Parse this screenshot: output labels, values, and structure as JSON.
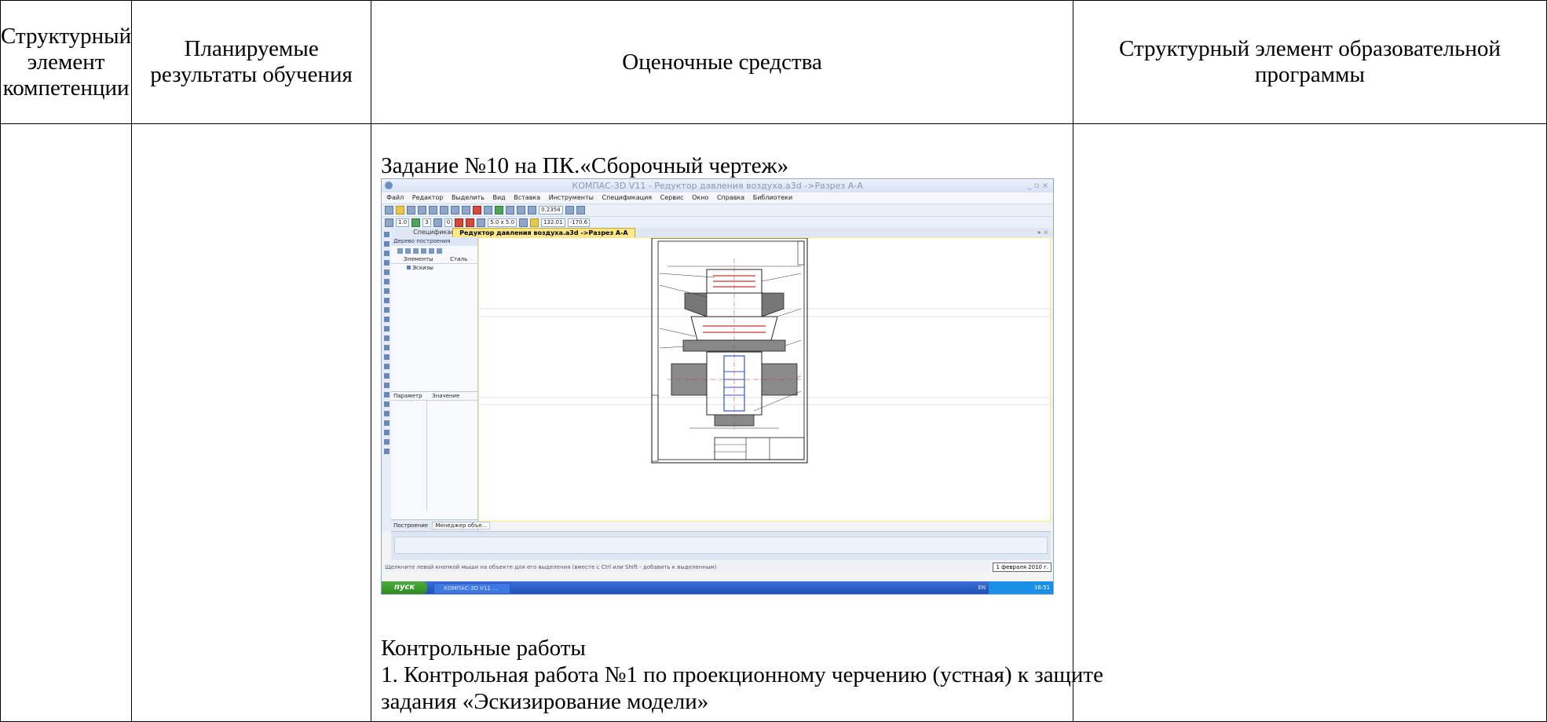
{
  "header": {
    "col1": "Структурный элемент компетенции",
    "col2": "Планируемые результаты обучения",
    "col3": "Оценочные средства",
    "col4": "Структурный элемент образовательной программы"
  },
  "content": {
    "task_title": "Задание №10 на ПК.«Сборочный чертеж»",
    "heading": "Контрольные работы",
    "item1_line1": "1. Контрольная работа №1 по проекционному черчению (устная) к защите",
    "item1_line2": "задания «Эскизирование модели»"
  },
  "screenshot": {
    "window_title": "КОМПАС-3D V11 - Редуктор давления воздуха.a3d ->Разрез А-А",
    "menu": [
      "Файл",
      "Редактор",
      "Выделить",
      "Вид",
      "Вставка",
      "Инструменты",
      "Спецификация",
      "Сервис",
      "Окно",
      "Справка",
      "Библиотеки"
    ],
    "toolbar_fields": [
      "1.0",
      "3",
      "0",
      "0.2354",
      "5.0 x 5.0",
      "132.01",
      "-170.6"
    ],
    "tab1": "Спецификация",
    "tab2": "Редуктор давления воздуха.a3d ->Разрез А-А",
    "panel_title": "Дерево построения",
    "col_elements": "Элементы",
    "col_style": "Стиль",
    "tree_item": "Эскизы",
    "col_param": "Параметр",
    "col_value": "Значение",
    "panel_tab1": "Построение",
    "panel_tab2": "Менеджер объе...",
    "status_text": "Щелкните левой кнопкой мыши на объекте для его выделения (вместе с Ctrl или Shift - добавить к выделенным)",
    "date": "1 февраля 2010 г.",
    "start": "пуск",
    "taskbar_item": "КОМПАС-3D V11 ...",
    "lang": "EN",
    "time": "16:51",
    "colors": {
      "tab_active": "#ffe88a",
      "taskbar": "#1f4fb8",
      "start": "#2d8b22"
    }
  }
}
